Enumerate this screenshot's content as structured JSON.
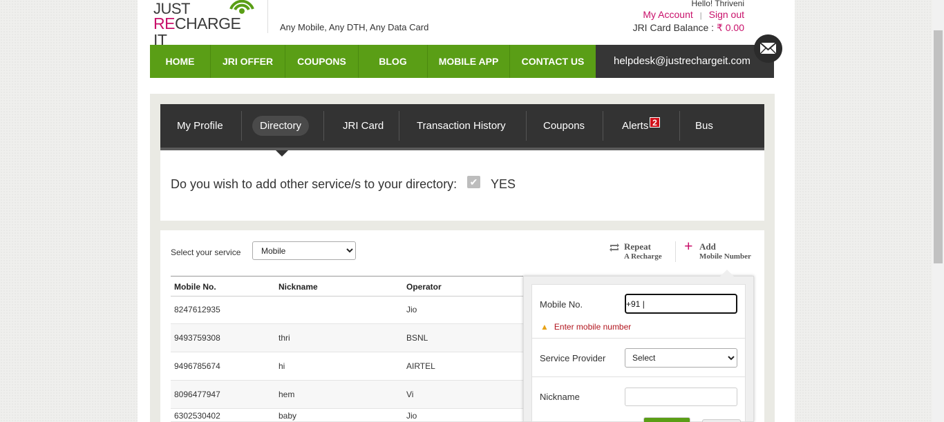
{
  "header": {
    "logo_line1": "JUST",
    "logo_re": "RE",
    "logo_charge": "CHARGE IT",
    "tagline": "Any Mobile, Any DTH, Any Data Card",
    "hello": "Hello! Thriveni",
    "my_account": "My Account",
    "sep": "|",
    "sign_out": "Sign out",
    "balance_label": "JRI Card Balance :",
    "balance_amount": "₹ 0.00",
    "accent_color": "#c8106a"
  },
  "nav": {
    "items": [
      "HOME",
      "JRI OFFER",
      "COUPONS",
      "BLOG",
      "MOBILE APP",
      "CONTACT US"
    ],
    "helpdesk": "helpdesk@justrechargeit.com",
    "color": "#5a9e16"
  },
  "tabs": {
    "items": [
      "My Profile",
      "Directory",
      "JRI Card",
      "Transaction History",
      "Coupons",
      "Alerts",
      "Bus"
    ],
    "active": "Directory",
    "alerts_badge": "2"
  },
  "directory": {
    "question": "Do you wish to add other service/s to your directory:",
    "yes_label": "YES",
    "checked": true
  },
  "service": {
    "label": "Select your service",
    "selected": "Mobile",
    "repeat_title": "Repeat",
    "repeat_sub": "A Recharge",
    "add_title": "Add",
    "add_sub": "Mobile Number"
  },
  "table": {
    "headers": [
      "Mobile No.",
      "Nickname",
      "Operator"
    ],
    "rows": [
      [
        "8247612935",
        "",
        "Jio"
      ],
      [
        "9493759308",
        "thri",
        "BSNL"
      ],
      [
        "9496785674",
        "hi",
        "AIRTEL"
      ],
      [
        "8096477947",
        "hem",
        "Vi"
      ],
      [
        "6302530402",
        "baby",
        "Jio"
      ]
    ]
  },
  "popup": {
    "mobile_label": "Mobile No.",
    "mobile_value": "+91 |",
    "error": "Enter mobile number",
    "provider_label": "Service Provider",
    "provider_selected": "Select",
    "nickname_label": "Nickname",
    "nickname_value": ""
  }
}
